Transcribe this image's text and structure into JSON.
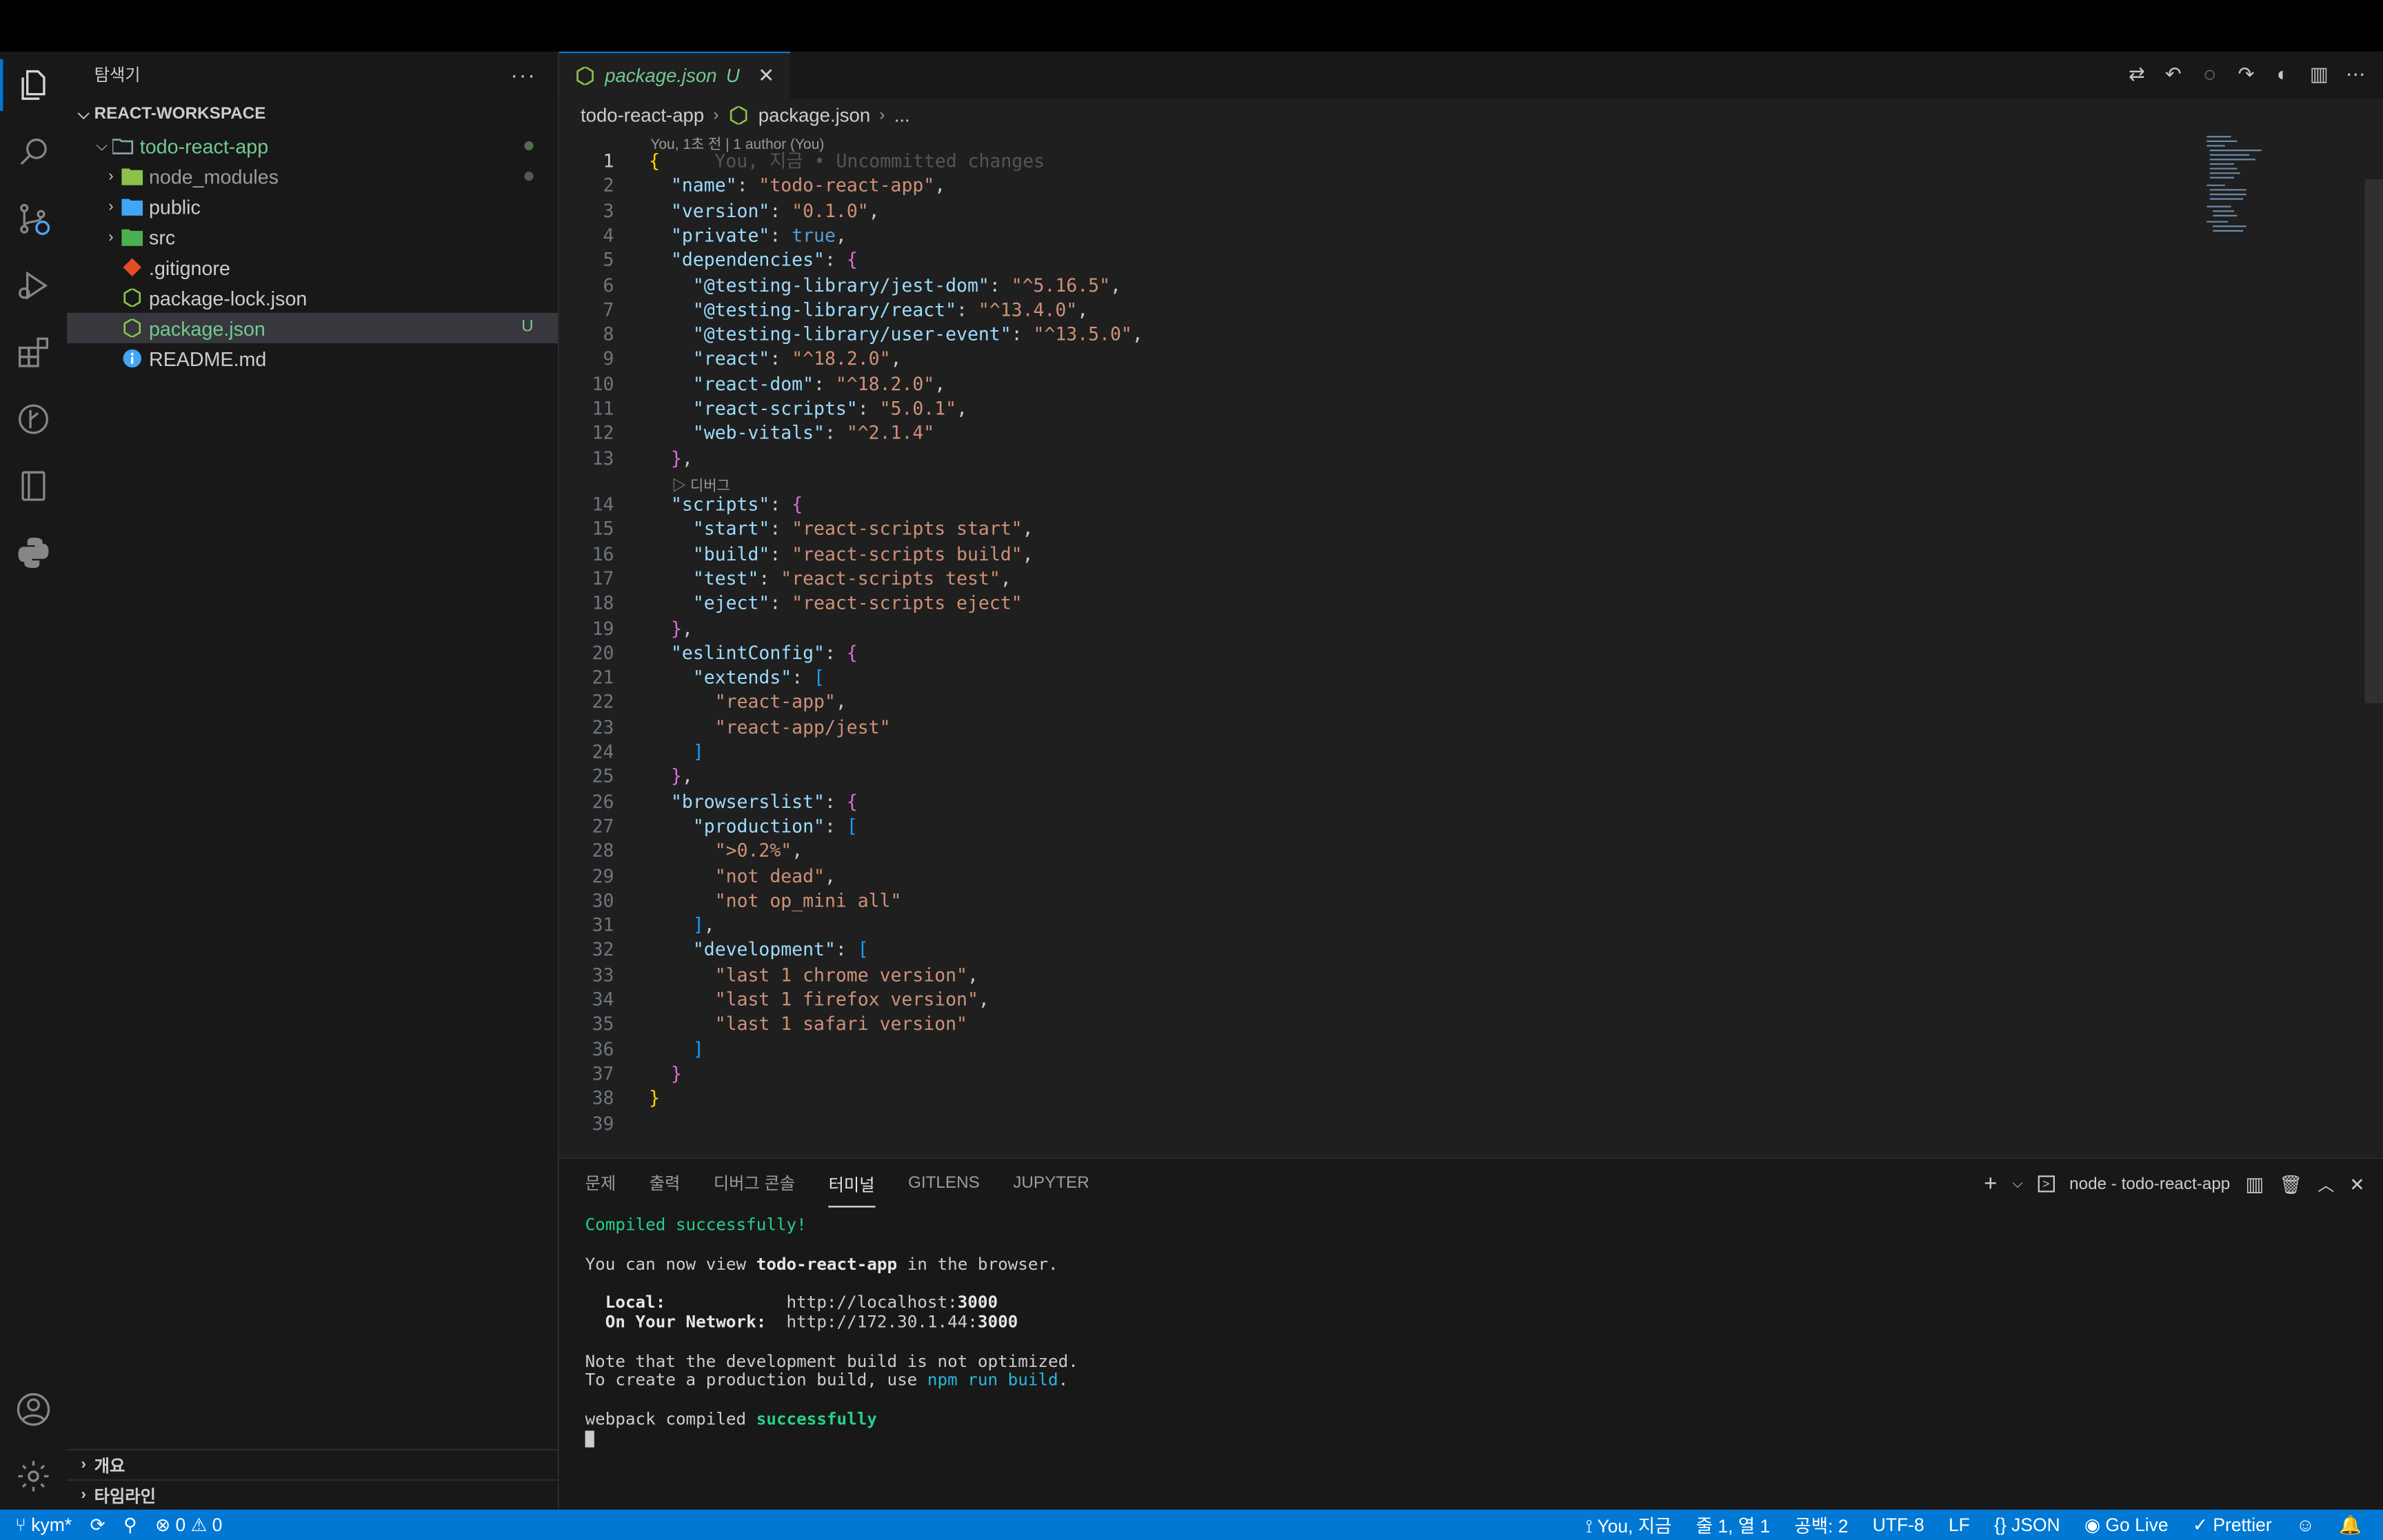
{
  "sidebar": {
    "title": "탐색기",
    "more": "···",
    "workspace": "REACT-WORKSPACE",
    "items": [
      {
        "label": "todo-react-app"
      },
      {
        "label": "node_modules"
      },
      {
        "label": "public"
      },
      {
        "label": "src"
      },
      {
        "label": ".gitignore"
      },
      {
        "label": "package-lock.json"
      },
      {
        "label": "package.json",
        "badge": "U"
      },
      {
        "label": "README.md"
      }
    ],
    "outline": "개요",
    "timeline": "타임라인"
  },
  "editor": {
    "tab": {
      "label": "package.json",
      "status": "U",
      "close": "✕"
    },
    "breadcrumb": {
      "folder": "todo-react-app",
      "file": "package.json",
      "more": "..."
    },
    "blame_top": "You, 1초 전 | 1 author (You)",
    "line1_blame": "You, 지금 • Uncommitted changes",
    "codelens_debug": "▷ 디버그",
    "line_numbers": [
      "1",
      "2",
      "3",
      "4",
      "5",
      "6",
      "7",
      "8",
      "9",
      "10",
      "11",
      "12",
      "13",
      "14",
      "15",
      "16",
      "17",
      "18",
      "19",
      "20",
      "21",
      "22",
      "23",
      "24",
      "25",
      "26",
      "27",
      "28",
      "29",
      "30",
      "31",
      "32",
      "33",
      "34",
      "35",
      "36",
      "37",
      "38",
      "39"
    ],
    "code": {
      "name_key": "\"name\"",
      "name_val": "\"todo-react-app\"",
      "version_key": "\"version\"",
      "version_val": "\"0.1.0\"",
      "private_key": "\"private\"",
      "private_val": "true",
      "deps_key": "\"dependencies\"",
      "d1k": "\"@testing-library/jest-dom\"",
      "d1v": "\"^5.16.5\"",
      "d2k": "\"@testing-library/react\"",
      "d2v": "\"^13.4.0\"",
      "d3k": "\"@testing-library/user-event\"",
      "d3v": "\"^13.5.0\"",
      "d4k": "\"react\"",
      "d4v": "\"^18.2.0\"",
      "d5k": "\"react-dom\"",
      "d5v": "\"^18.2.0\"",
      "d6k": "\"react-scripts\"",
      "d6v": "\"5.0.1\"",
      "d7k": "\"web-vitals\"",
      "d7v": "\"^2.1.4\"",
      "scripts_key": "\"scripts\"",
      "s1k": "\"start\"",
      "s1v": "\"react-scripts start\"",
      "s2k": "\"build\"",
      "s2v": "\"react-scripts build\"",
      "s3k": "\"test\"",
      "s3v": "\"react-scripts test\"",
      "s4k": "\"eject\"",
      "s4v": "\"react-scripts eject\"",
      "eslint_key": "\"eslintConfig\"",
      "extends_key": "\"extends\"",
      "e1": "\"react-app\"",
      "e2": "\"react-app/jest\"",
      "browsers_key": "\"browserslist\"",
      "prod_key": "\"production\"",
      "p1": "\">0.2%\"",
      "p2": "\"not dead\"",
      "p3": "\"not op_mini all\"",
      "dev_key": "\"development\"",
      "v1": "\"last 1 chrome version\"",
      "v2": "\"last 1 firefox version\"",
      "v3": "\"last 1 safari version\""
    }
  },
  "panel": {
    "tabs": [
      "문제",
      "출력",
      "디버그 콘솔",
      "터미널",
      "GITLENS",
      "JUPYTER"
    ],
    "terminal_name": "node - todo-react-app",
    "terminal": {
      "l1": "Compiled successfully!",
      "l2a": "You can now view ",
      "l2b": "todo-react-app",
      "l2c": " in the browser.",
      "l3a": "  Local:",
      "l3b": "            http://localhost:",
      "l3c": "3000",
      "l4a": "  On Your Network:",
      "l4b": "  http://172.30.1.44:",
      "l4c": "3000",
      "l5": "Note that the development build is not optimized.",
      "l6a": "To create a production build, use ",
      "l6b": "npm run build",
      "l6c": ".",
      "l7a": "webpack compiled ",
      "l7b": "successfully"
    }
  },
  "status": {
    "branch": "kym*",
    "errors": "0",
    "warnings": "0",
    "blame": "You, 지금",
    "position": "줄 1, 열 1",
    "spaces": "공백: 2",
    "encoding": "UTF-8",
    "eol": "LF",
    "language": "JSON",
    "golive": "Go Live",
    "prettier": "Prettier"
  },
  "colors": {
    "accent": "#0078d4",
    "untracked": "#73c991",
    "editor_bg": "#1f1f1f",
    "sidebar_bg": "#181818"
  }
}
